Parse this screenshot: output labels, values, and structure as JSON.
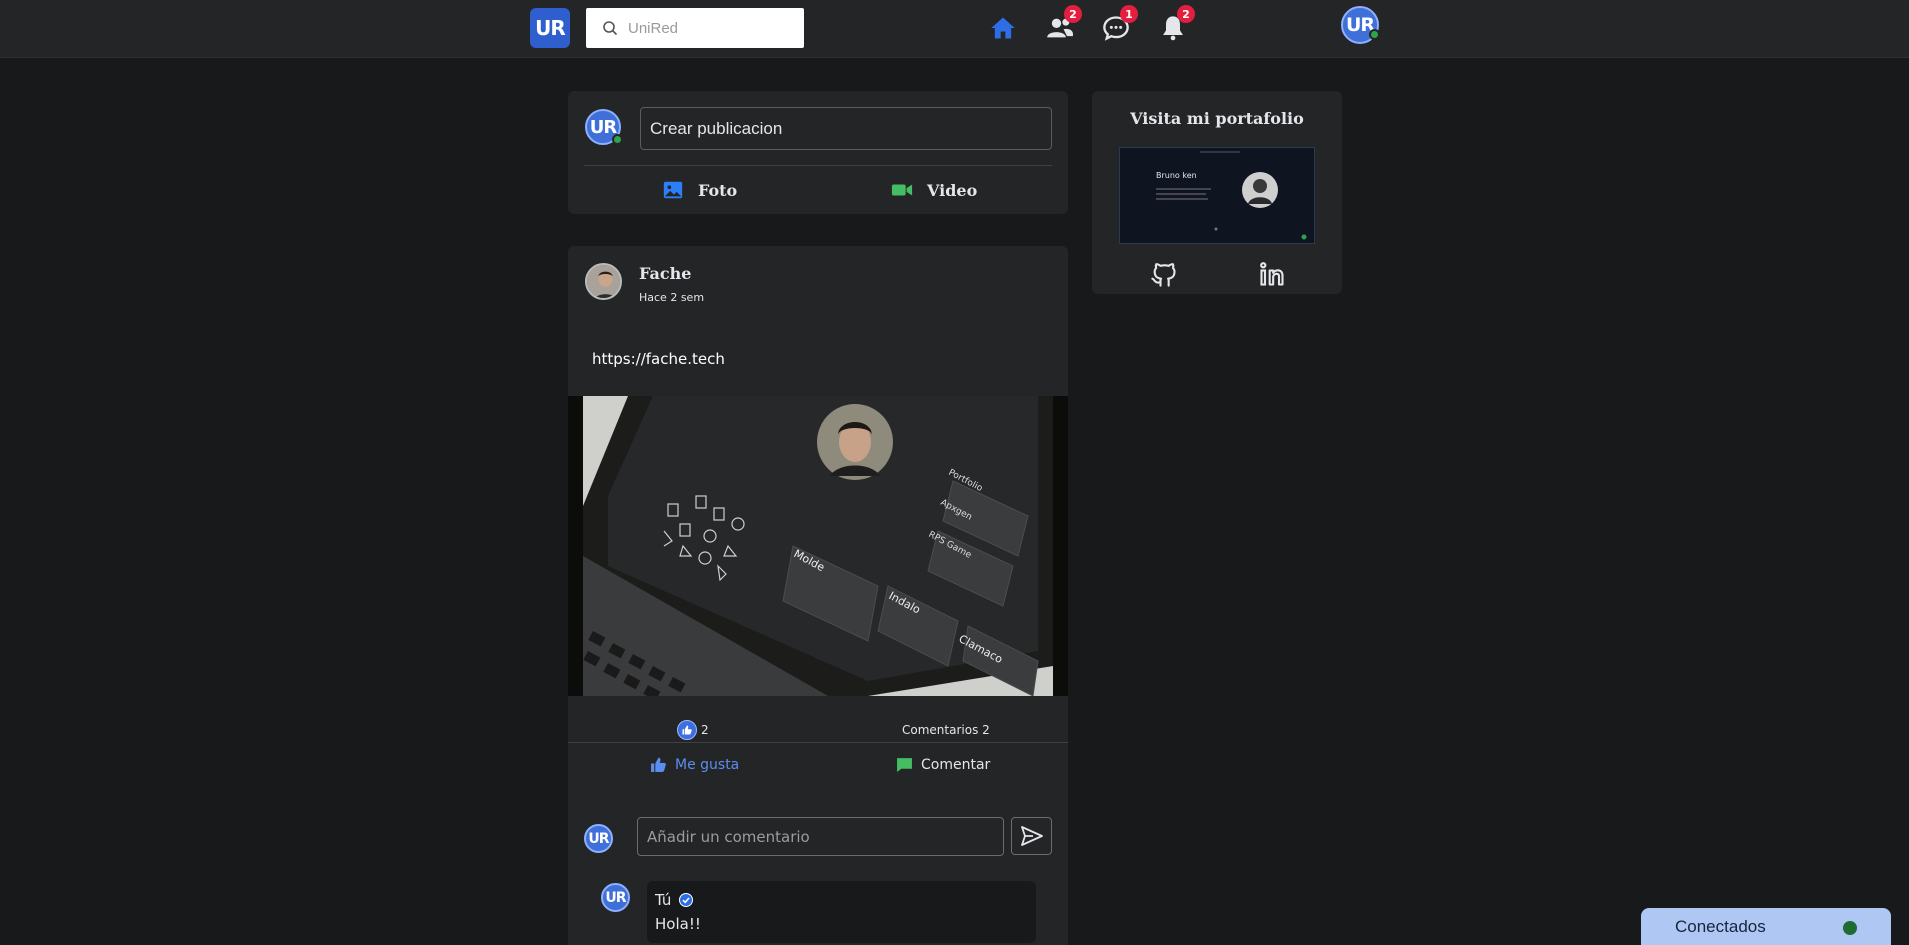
{
  "header": {
    "logo": "UR",
    "search_placeholder": "UniRed",
    "badges": {
      "friends": "2",
      "messages": "1",
      "notifications": "2"
    },
    "avatar": "UR"
  },
  "create_post": {
    "avatar": "UR",
    "placeholder": "Crear publicacion",
    "photo_label": "Foto",
    "video_label": "Video"
  },
  "post": {
    "author": "Fache",
    "time": "Hace 2 sem",
    "text": "https://fache.tech",
    "image_texts": {
      "project1": "Portfolio",
      "project2": "Apxgen",
      "project3": "RPS Game",
      "card1": "Molde",
      "card2": "Indalo",
      "card3": "Clamaco"
    },
    "like_count": "2",
    "comments_label": "Comentarios 2",
    "like_label": "Me gusta",
    "comment_label": "Comentar",
    "comment_avatar": "UR",
    "comment_placeholder": "Añadir un comentario",
    "comments": [
      {
        "avatar": "UR",
        "name": "Tú",
        "text": "Hola!!"
      }
    ]
  },
  "portfolio": {
    "title": "Visita mi portafolio",
    "thumb_name": "Bruno ken"
  },
  "connected": {
    "label": "Conectados"
  },
  "colors": {
    "accent": "#2d6ee6",
    "background": "#18191a",
    "card": "#242526",
    "online": "#31a24c",
    "badge": "#e41e3f"
  }
}
